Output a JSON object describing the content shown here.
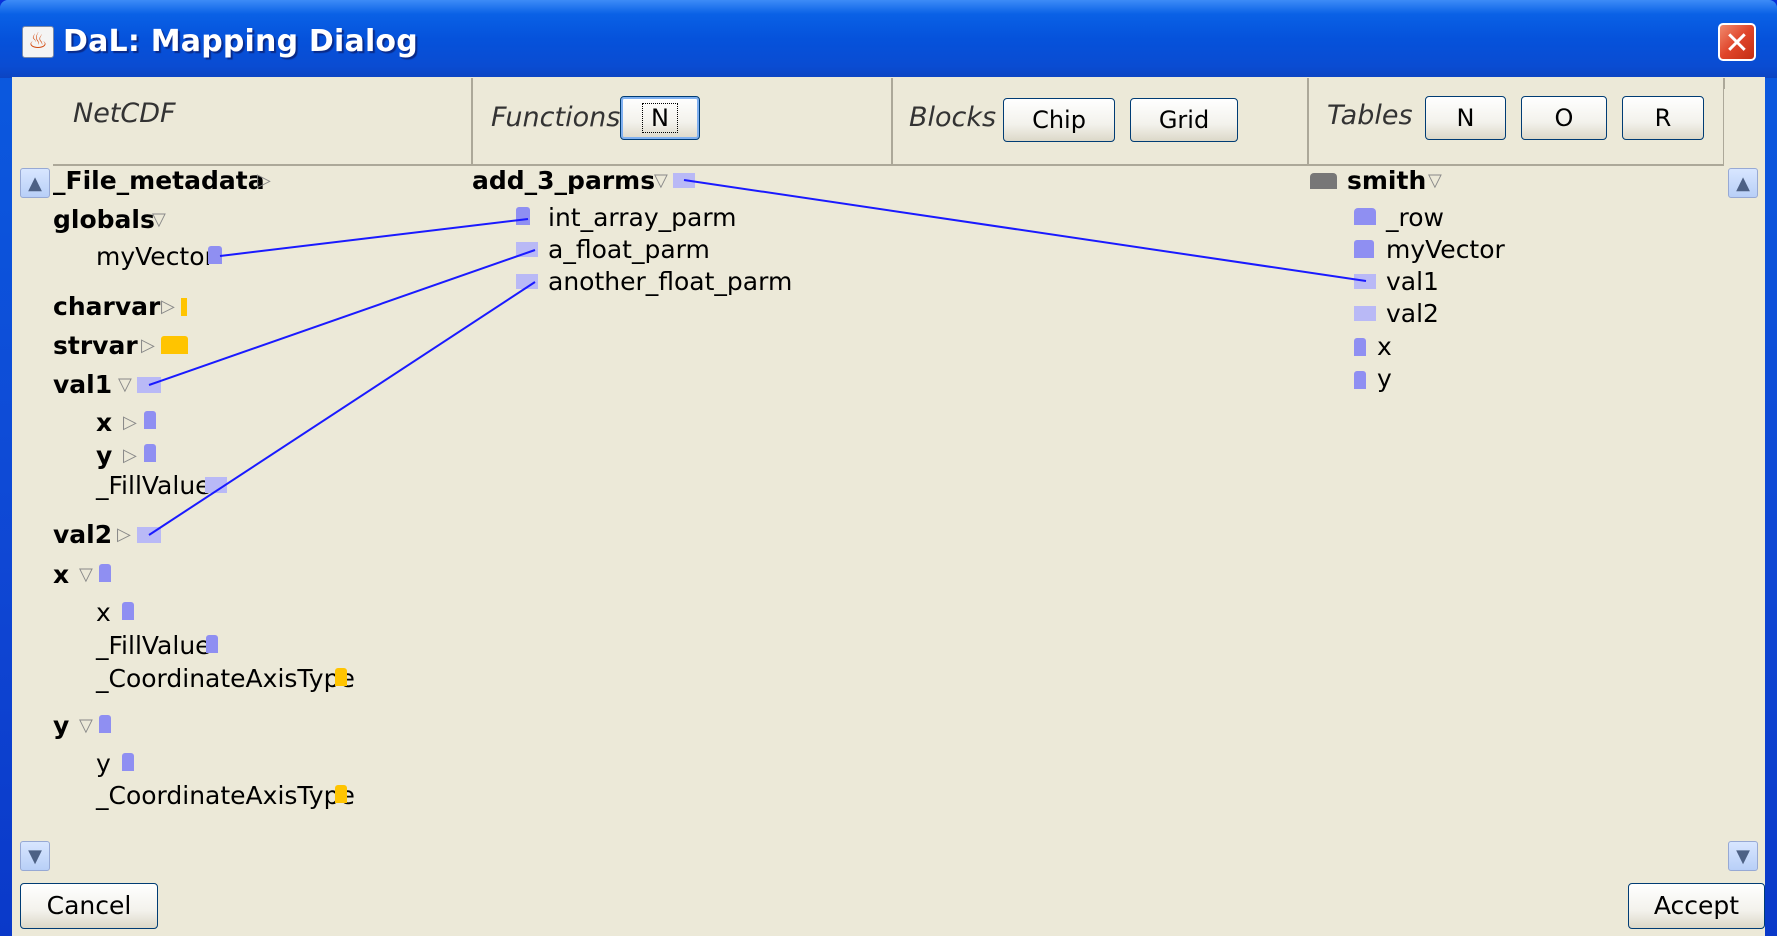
{
  "window": {
    "title": "DaL: Mapping Dialog",
    "close_symbol": "✕"
  },
  "headers": {
    "netcdf": {
      "label": "NetCDF"
    },
    "functions": {
      "label": "Functions",
      "buttons": [
        "N"
      ]
    },
    "blocks": {
      "label": "Blocks",
      "buttons": [
        "Chip",
        "Grid"
      ]
    },
    "tables": {
      "label": "Tables",
      "buttons": [
        "N",
        "O",
        "R"
      ]
    }
  },
  "netcdf_tree": [
    {
      "label": "_File_metadata",
      "bold": true
    },
    {
      "label": "globals",
      "bold": true
    },
    {
      "label": "myVector",
      "bold": false
    },
    {
      "label": "charvar",
      "bold": true
    },
    {
      "label": "strvar",
      "bold": true
    },
    {
      "label": "val1",
      "bold": true
    },
    {
      "label": "x",
      "bold": true
    },
    {
      "label": "y",
      "bold": true
    },
    {
      "label": "_FillValue",
      "bold": false
    },
    {
      "label": "val2",
      "bold": true
    },
    {
      "label": "x",
      "bold": true
    },
    {
      "label": "x",
      "bold": false
    },
    {
      "label": "_FillValue",
      "bold": false
    },
    {
      "label": "_CoordinateAxisType",
      "bold": false
    },
    {
      "label": "y",
      "bold": true
    },
    {
      "label": "y",
      "bold": false
    },
    {
      "label": "_CoordinateAxisType",
      "bold": false
    }
  ],
  "function_tree": [
    {
      "label": "add_3_parms",
      "bold": true
    },
    {
      "label": "int_array_parm",
      "bold": false
    },
    {
      "label": "a_float_parm",
      "bold": false
    },
    {
      "label": "another_float_parm",
      "bold": false
    }
  ],
  "table_tree": [
    {
      "label": "smith",
      "bold": true
    },
    {
      "label": "_row",
      "bold": false
    },
    {
      "label": "myVector",
      "bold": false
    },
    {
      "label": "val1",
      "bold": false
    },
    {
      "label": "val2",
      "bold": false
    },
    {
      "label": "x",
      "bold": false
    },
    {
      "label": "y",
      "bold": false
    }
  ],
  "colors": {
    "link_line": "#1a1aff",
    "swatch_blue": "#8f8ff2",
    "swatch_gold": "#ffc400"
  },
  "footer": {
    "cancel_label": "Cancel",
    "accept_label": "Accept"
  }
}
